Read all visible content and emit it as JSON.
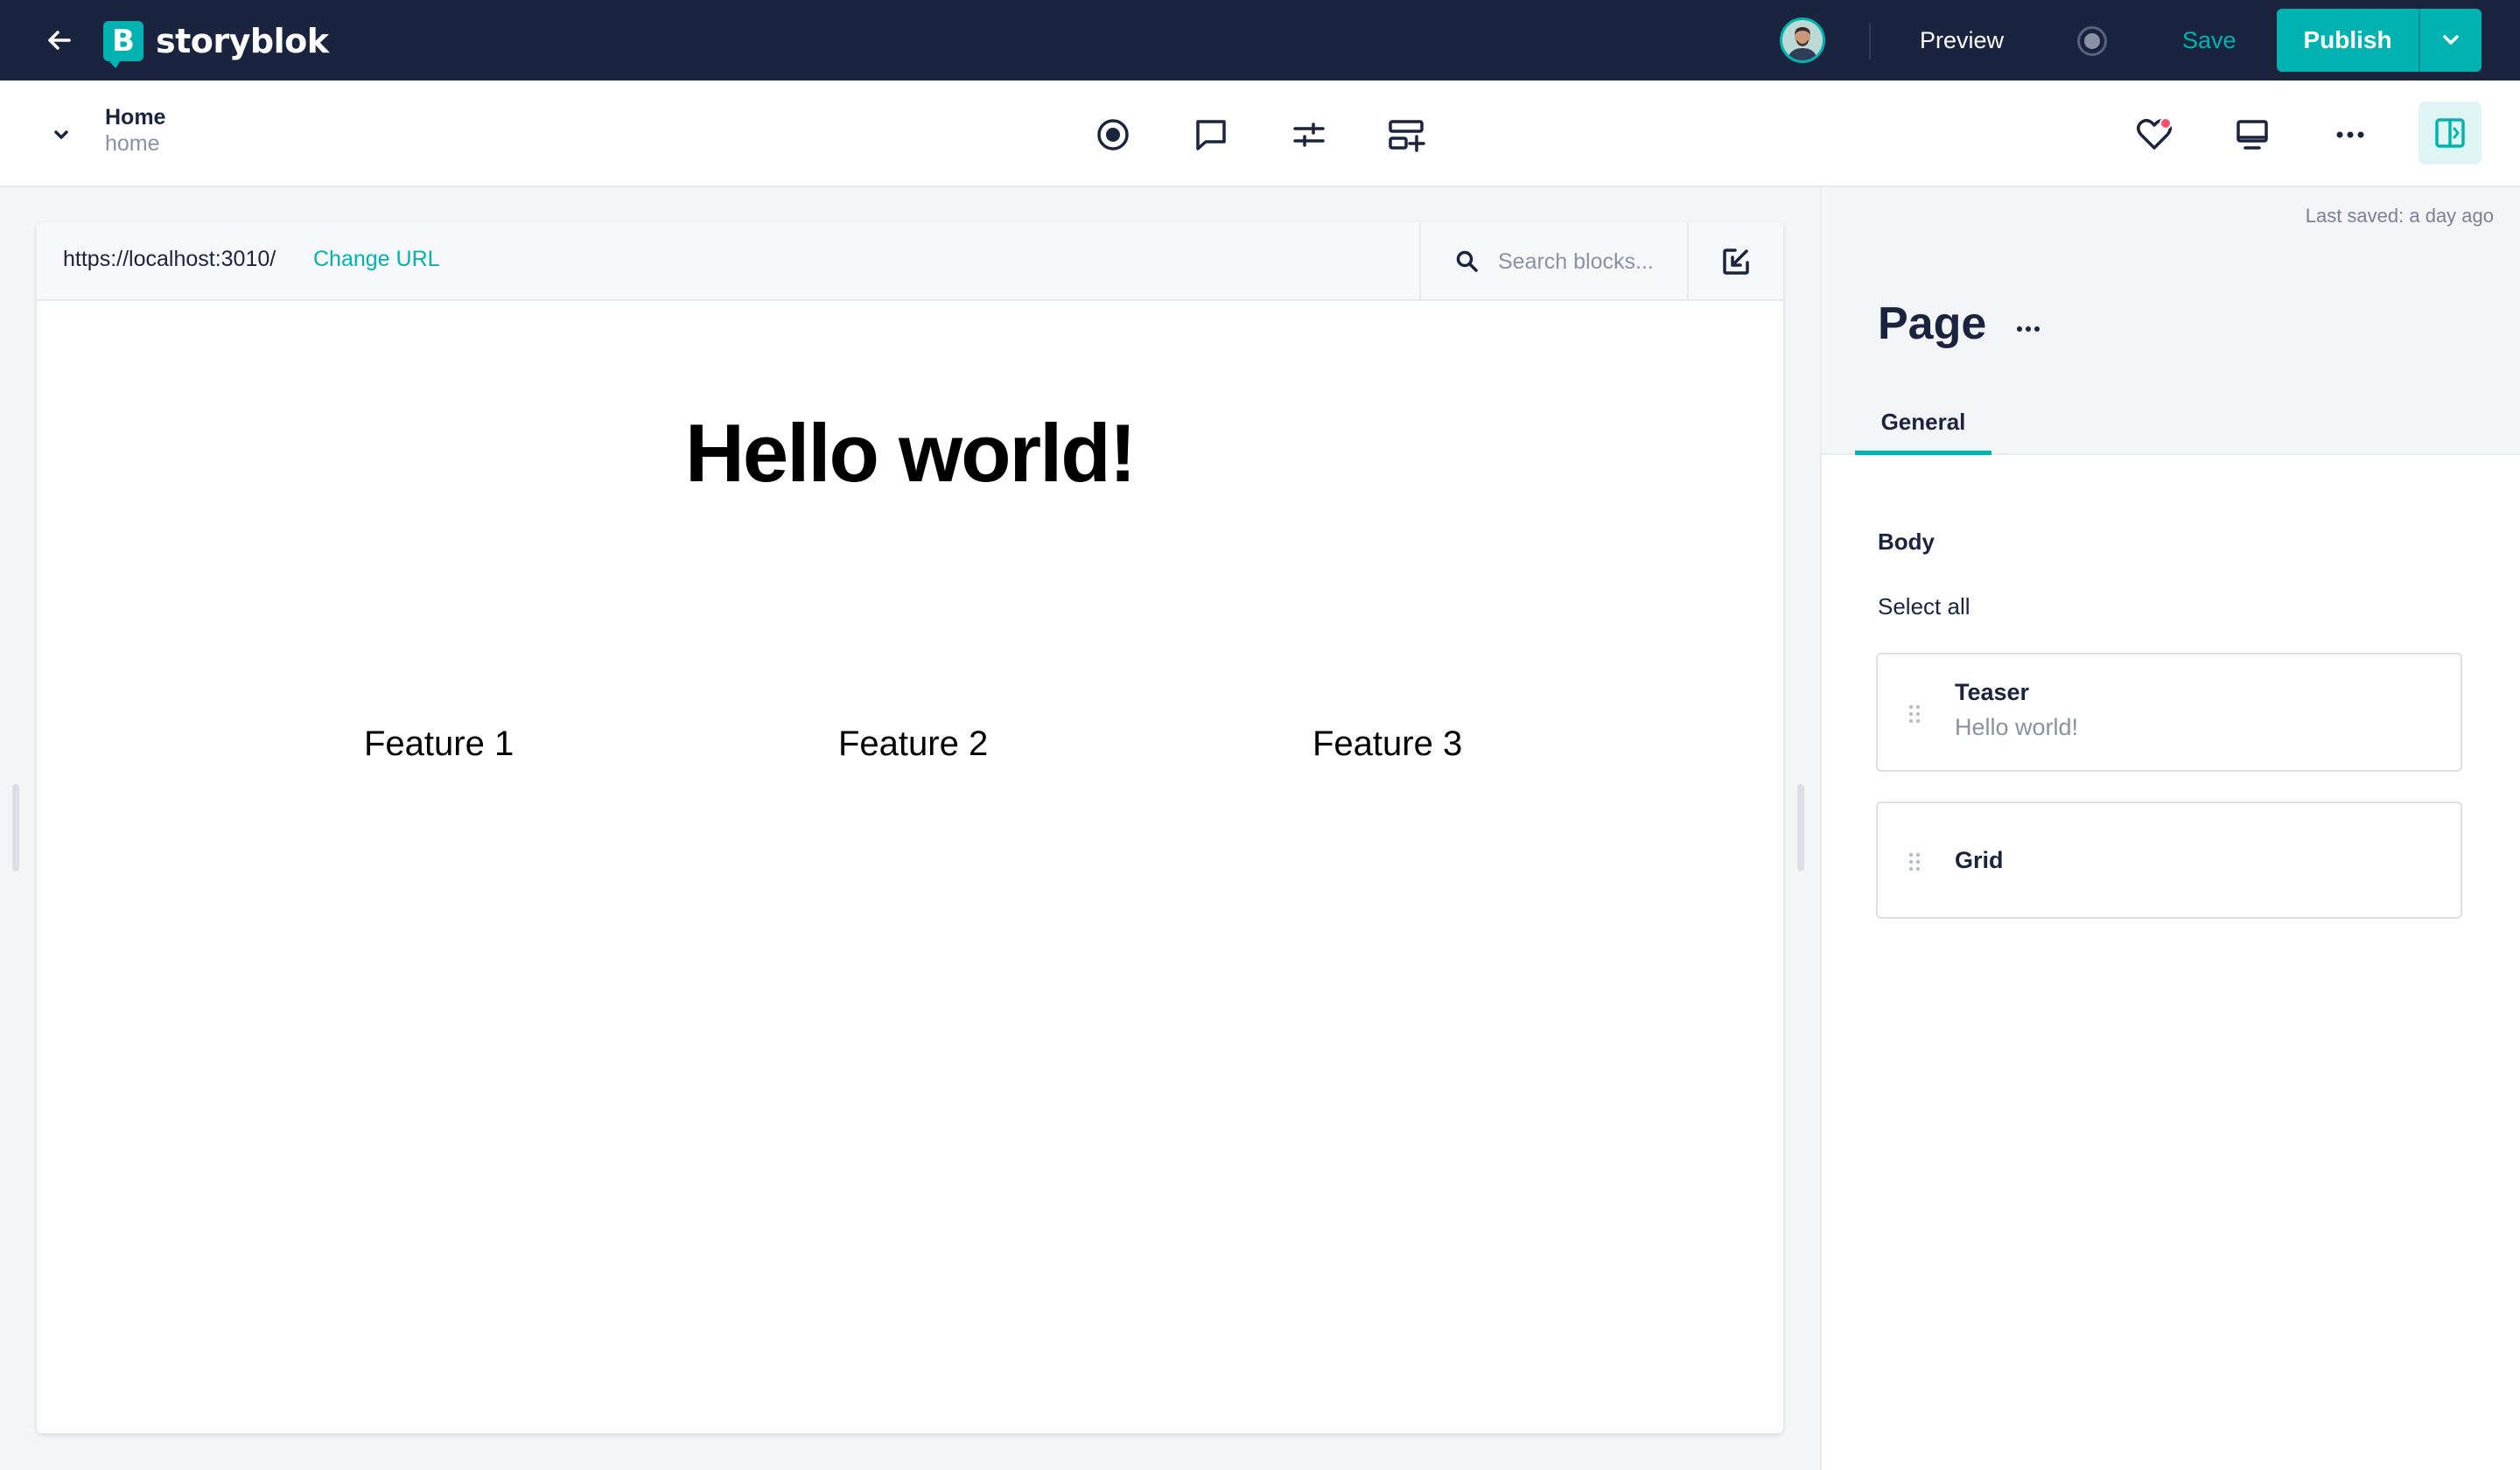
{
  "app": {
    "brand": "storyblok",
    "brand_mark": "B",
    "accent_color": "#00b3b0",
    "topbar_color": "#1b243f"
  },
  "topbar": {
    "preview_label": "Preview",
    "save_label": "Save",
    "publish_label": "Publish"
  },
  "story": {
    "title": "Home",
    "slug": "home"
  },
  "toolbar_icons": [
    "target-icon",
    "comment-icon",
    "sliders-icon",
    "add-block-icon"
  ],
  "toolbar_right_icons": [
    "heart-icon",
    "monitor-icon",
    "more-icon",
    "sidebar-toggle-icon"
  ],
  "preview": {
    "url": "https://localhost:3010/",
    "change_url_label": "Change URL",
    "search_placeholder": "Search blocks...",
    "hero_title": "Hello world!",
    "features": [
      "Feature 1",
      "Feature 2",
      "Feature 3"
    ]
  },
  "panel": {
    "last_saved": "Last saved: a day ago",
    "page_title": "Page",
    "tab_general": "General",
    "body_label": "Body",
    "select_all": "Select all",
    "blocks": [
      {
        "name": "Teaser",
        "subtitle": "Hello world!"
      },
      {
        "name": "Grid",
        "subtitle": ""
      }
    ]
  }
}
